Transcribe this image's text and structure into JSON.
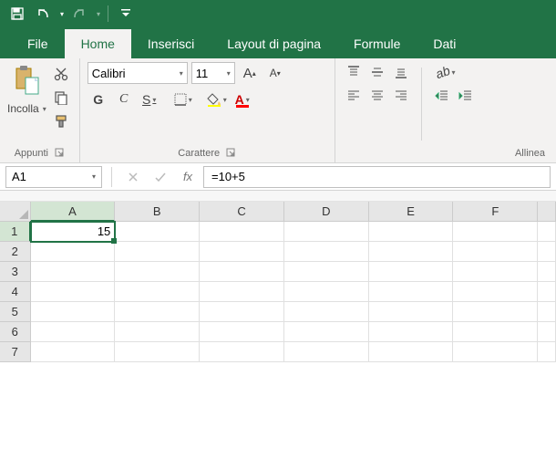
{
  "tabs": {
    "file": "File",
    "home": "Home",
    "insert": "Inserisci",
    "layout": "Layout di pagina",
    "formulas": "Formule",
    "data": "Dati"
  },
  "groups": {
    "clipboard": {
      "label": "Appunti",
      "paste": "Incolla"
    },
    "font": {
      "label": "Carattere",
      "name": "Calibri",
      "size": "11",
      "bold": "G",
      "italic": "C",
      "underline": "S",
      "grow": "A",
      "shrink": "A",
      "fontcolor": "A"
    },
    "alignment": {
      "label": "Allinea"
    }
  },
  "formula_bar": {
    "name_box": "A1",
    "fx": "fx",
    "formula": "=10+5"
  },
  "columns": [
    "A",
    "B",
    "C",
    "D",
    "E",
    "F"
  ],
  "rows": [
    "1",
    "2",
    "3",
    "4",
    "5",
    "6",
    "7"
  ],
  "cells": {
    "A1": "15"
  },
  "active_cell": "A1"
}
